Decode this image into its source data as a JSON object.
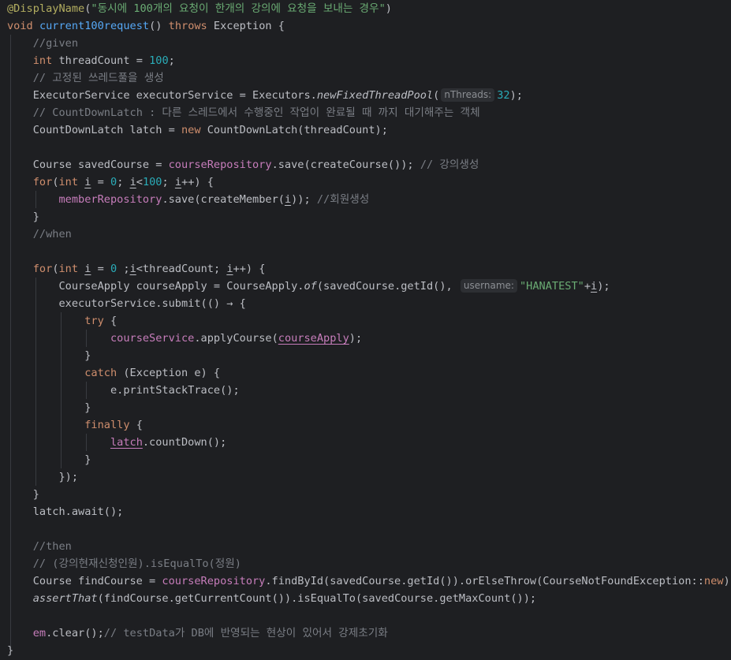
{
  "lines": [
    [
      "@DisplayName",
      "(",
      "\"동시에 100개의 요청이 한개의 강의에 요청을 보내는 경우\"",
      ")"
    ],
    [
      "void",
      " ",
      "current100request",
      "() ",
      "throws",
      " Exception {"
    ],
    [
      "    ",
      "//given"
    ],
    [
      "    ",
      "int",
      " threadCount = ",
      "100",
      ";"
    ],
    [
      "    ",
      "// 고정된 쓰레드풀을 생성"
    ],
    [
      "    ExecutorService executorService = Executors.",
      "newFixedThreadPool",
      "(",
      "nThreads:",
      "32",
      ");"
    ],
    [
      "    ",
      "// CountDownLatch : 다른 스레드에서 수행중인 작업이 완료될 때 까지 대기해주는 객체"
    ],
    [
      "    CountDownLatch latch = ",
      "new",
      " CountDownLatch(threadCount);"
    ],
    [
      ""
    ],
    [
      "    Course savedCourse = ",
      "courseRepository",
      ".save(createCourse()); ",
      "// 강의생성"
    ],
    [
      "    ",
      "for",
      "(",
      "int",
      " ",
      "i",
      " = ",
      "0",
      "; ",
      "i",
      "<",
      "100",
      "; ",
      "i",
      "++) {"
    ],
    [
      "        ",
      "memberRepository",
      ".save(createMember(",
      "i",
      ")); ",
      "//회원생성"
    ],
    [
      "    }"
    ],
    [
      "    ",
      "//when"
    ],
    [
      ""
    ],
    [
      "    ",
      "for",
      "(",
      "int",
      " ",
      "i",
      " = ",
      "0",
      " ;",
      "i",
      "<threadCount; ",
      "i",
      "++) {"
    ],
    [
      "        CourseApply courseApply = CourseApply.",
      "of",
      "(savedCourse.getId(), ",
      "username:",
      "\"HANATEST\"",
      "+",
      "i",
      ");"
    ],
    [
      "        executorService.submit(() → {"
    ],
    [
      "            ",
      "try",
      " {"
    ],
    [
      "                ",
      "courseService",
      ".applyCourse(",
      "courseApply",
      ");"
    ],
    [
      "            }"
    ],
    [
      "            ",
      "catch",
      " (Exception e) {"
    ],
    [
      "                e.printStackTrace();"
    ],
    [
      "            }"
    ],
    [
      "            ",
      "finally",
      " {"
    ],
    [
      "                ",
      "latch",
      ".countDown();"
    ],
    [
      "            }"
    ],
    [
      "        });"
    ],
    [
      "    }"
    ],
    [
      "    latch.await();"
    ],
    [
      ""
    ],
    [
      "    ",
      "//then"
    ],
    [
      "    ",
      "// (강의현재신청인원).isEqualTo(정원)"
    ],
    [
      "    Course findCourse = ",
      "courseRepository",
      ".findById(savedCourse.getId()).orElseThrow(CourseNotFoundException::",
      "new",
      ");"
    ],
    [
      "    ",
      "assertThat",
      "(findCourse.getCurrentCount()).isEqualTo(savedCourse.getMaxCount());"
    ],
    [
      ""
    ],
    [
      "    ",
      "em",
      ".clear();",
      "// testData가 DB에 반영되는 현상이 있어서 강제초기화"
    ],
    [
      "}"
    ]
  ]
}
